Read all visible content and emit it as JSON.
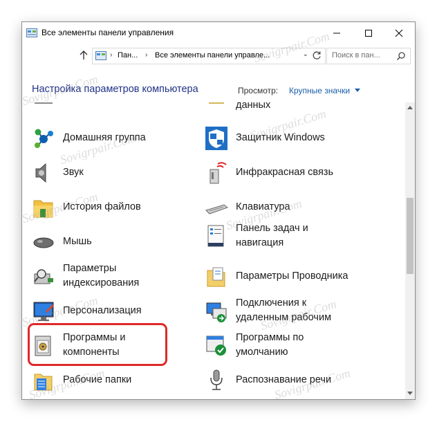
{
  "window": {
    "title": "Все элементы панели управления",
    "controls": {
      "minimize_icon": "minimize-icon",
      "maximize_icon": "maximize-icon",
      "close_icon": "close-icon"
    }
  },
  "navigation": {
    "breadcrumbs": [
      "Пан...",
      "Все элементы панели управле..."
    ],
    "search_placeholder": "Поиск в пан..."
  },
  "header": {
    "title": "Настройка параметров компьютера",
    "view_label": "Просмотр:",
    "view_value": "Крупные значки"
  },
  "items": {
    "left_partial": "",
    "right_partial": "данных",
    "homegroup": "Домашняя группа",
    "defender": "Защитник Windows",
    "sound": "Звук",
    "infrared": "Инфракрасная связь",
    "file_history": "История файлов",
    "keyboard": "Клавиатура",
    "mouse": "Мышь",
    "taskbar_1": "Панель задач и",
    "taskbar_2": "навигация",
    "indexing_1": "Параметры",
    "indexing_2": "индексирования",
    "explorer_options": "Параметры Проводника",
    "personalization": "Персонализация",
    "remote_1": "Подключения к",
    "remote_2": "удаленным рабочим",
    "programs_1": "Программы и",
    "programs_2": "компоненты",
    "default_programs_1": "Программы по",
    "default_programs_2": "умолчанию",
    "work_folders": "Рабочие папки",
    "speech": "Распознавание речи"
  },
  "watermark": "Sovigrpair.Com",
  "colors": {
    "link": "#1a5ea8",
    "header": "#1e3287",
    "highlight": "#e02828",
    "green_label": "#2e7d1f"
  }
}
